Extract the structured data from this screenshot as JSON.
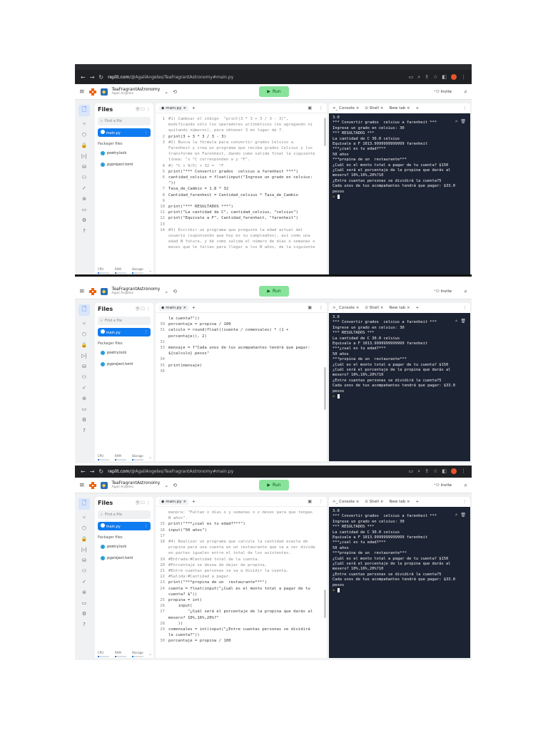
{
  "browser": {
    "url_host": "replit.com",
    "url_path": "/@AgaliAngeles/TeaFragrantAstronomy#main.py"
  },
  "header": {
    "project_name": "TeaFragrantAstronomy",
    "owner": "Agali Angeles",
    "run_label": "Run",
    "invite_label": "Invite"
  },
  "files": {
    "title": "Files",
    "find_placeholder": "Find a file",
    "items": [
      "main.py"
    ],
    "packager_title": "Packager files",
    "packager_items": [
      "poetry.lock",
      "pyproject.toml"
    ]
  },
  "resources": [
    "CPU",
    "RAM",
    "Storage"
  ],
  "editor": {
    "tab_label": "main.py"
  },
  "console": {
    "tabs": [
      "Console",
      "Shell",
      "New tab"
    ],
    "output": [
      "3.0",
      "*** Convertir grados  celsius a farenheit ***",
      "Ingrese un grado en celsius: 30",
      "*** RESULTADOS ***",
      "La cantidad de C 30.0 celsius",
      "Equivale a F 1013.9999999999999 farenheit",
      "***¿cual es tu edad?***",
      "50 años",
      "***propina de un  restaurante***",
      "¿Cuál es el monto total a pagar de tu cuenta? $150",
      "¿Cuál será el porcentaje de la propina que darás al mesero? 10%,16%,20%?10",
      "¿Entre cuantas personas se dividirá la cuenta?5",
      "Cada unos de tus acompañantes tendrá que pagar: $33.0 pesos"
    ],
    "prompt": ">"
  },
  "panels": [
    {
      "browser": true,
      "code": [
        {
          "n": "1",
          "t": "#1) Cambiar el código  \"print(3 * 3 + 3 / 3 - 3)\",",
          "c": true
        },
        {
          "n": "",
          "t": "modificando sólo los operadores aritméticos (no agregando ni",
          "c": true
        },
        {
          "n": "",
          "t": "quitando números), para obtener 3 en lugar de 7.",
          "c": true
        },
        {
          "n": "2",
          "t": "print(3 + 3 * 3 / 3 - 3)"
        },
        {
          "n": "3",
          "t": "#2) Busca la fórmula para convertir grados Celsius a",
          "c": true
        },
        {
          "n": "",
          "t": "Farenheit y crea un programa que reciba grados Celsius y los",
          "c": true
        },
        {
          "n": "",
          "t": "transforme en Farenheit, dando como salida final la siguiente",
          "c": true
        },
        {
          "n": "",
          "t": "línea: \"x °C corresponden a y °F\".",
          "c": true
        },
        {
          "n": "4",
          "t": "#( °C × 9/5) + 32 =  °F",
          "c": true
        },
        {
          "n": "5",
          "t": "print(\"*** Convertir grados  celsius a farenheit ***\")"
        },
        {
          "n": "6",
          "t": "cantidad_celsius = float(input(\"Ingrese un grado en celsius:"
        },
        {
          "n": "",
          "t": "\"))"
        },
        {
          "n": "7",
          "t": "Tasa_de_Cambio = 1.8 * 32"
        },
        {
          "n": "8",
          "t": "Cantidad_farenheit = Cantidad_celsius * Tasa_de_Cambio"
        },
        {
          "n": "9",
          "t": ""
        },
        {
          "n": "10",
          "t": "print(\"*** RESULTADOS ***\")"
        },
        {
          "n": "11",
          "t": "print(\"La cantidad de C\", cantidad_celsius, \"celsius\")"
        },
        {
          "n": "12",
          "t": "print(\"Equivale a F\", Cantidad_farenheit, \"farenheit\")"
        },
        {
          "n": "13",
          "t": ""
        },
        {
          "n": "14",
          "t": "#3) Escribir un programa que pregunte la edad actual del",
          "c": true
        },
        {
          "n": "",
          "t": "usuario (suponiendo que hoy es su cumpleaños), así como una",
          "c": true
        },
        {
          "n": "",
          "t": "edad N futura, y dé como salida el número de días o semanas o",
          "c": true
        },
        {
          "n": "",
          "t": "meses que le faltan para llegar a los N años, de la siguiente",
          "c": true
        }
      ]
    },
    {
      "browser": false,
      "code": [
        {
          "n": "",
          "t": "la cuenta?\"))"
        },
        {
          "n": "30",
          "t": "porcentaje = propina / 100"
        },
        {
          "n": "31",
          "t": "calculo = round(float((cuenta / comensales) * (1 +"
        },
        {
          "n": "",
          "t": "porcentaje)), 2)"
        },
        {
          "n": "32",
          "t": ""
        },
        {
          "n": "33",
          "t": "mensaje = f\"Cada unos de tus acompañantes tendrá que pagar:"
        },
        {
          "n": "",
          "t": "${calculo} pesos\""
        },
        {
          "n": "34",
          "t": ""
        },
        {
          "n": "35",
          "t": "print(mensaje)"
        },
        {
          "n": "36",
          "t": ""
        }
      ]
    },
    {
      "browser": true,
      "code": [
        {
          "n": "",
          "t": "manera: \"Faltan x días o y semanas o z meses para que tengas",
          "c": true
        },
        {
          "n": "",
          "t": "N años\".",
          "c": true
        },
        {
          "n": "15",
          "t": "print(\"***¿cual es tu edad?***\")"
        },
        {
          "n": "16",
          "t": "input(\"50 años\")"
        },
        {
          "n": "17",
          "t": ""
        },
        {
          "n": "18",
          "t": "#4) Realizar un programa que calcule la cantidad exacta de",
          "c": true
        },
        {
          "n": "",
          "t": "propina para una cuenta en un restaurante que va a ser divida",
          "c": true
        },
        {
          "n": "",
          "t": "en partes iguales entre el total de los asistentes.",
          "c": true
        },
        {
          "n": "19",
          "t": "#Entrada:#Cantidad total de la cuenta.",
          "c": true
        },
        {
          "n": "20",
          "t": "#Porcentaje se desea de dejar de propina.",
          "c": true
        },
        {
          "n": "21",
          "t": "#Entre cuantas personas se va a dividir la cuenta.",
          "c": true
        },
        {
          "n": "22",
          "t": "#Salida:#Cantidad a pagar.",
          "c": true
        },
        {
          "n": "23",
          "t": "print(\"***propina de un  restaurante***\")"
        },
        {
          "n": "24",
          "t": "cuenta = float(input(\"¿Cuál es el monto total a pagar de tu"
        },
        {
          "n": "",
          "t": "cuenta? $\"))"
        },
        {
          "n": "25",
          "t": "propina = int("
        },
        {
          "n": "26",
          "t": "    input("
        },
        {
          "n": "27",
          "t": "        \"¿Cuál será el porcentaje de la propina que darás al"
        },
        {
          "n": "",
          "t": "mesero? 10%,16%,20%?\""
        },
        {
          "n": "28",
          "t": "    ))"
        },
        {
          "n": "29",
          "t": "comensales = int(input(\"¿Entre cuantas personas se dividirá"
        },
        {
          "n": "",
          "t": "la cuenta?\"))"
        },
        {
          "n": "30",
          "t": "porcentaje = propina / 100"
        }
      ]
    }
  ]
}
